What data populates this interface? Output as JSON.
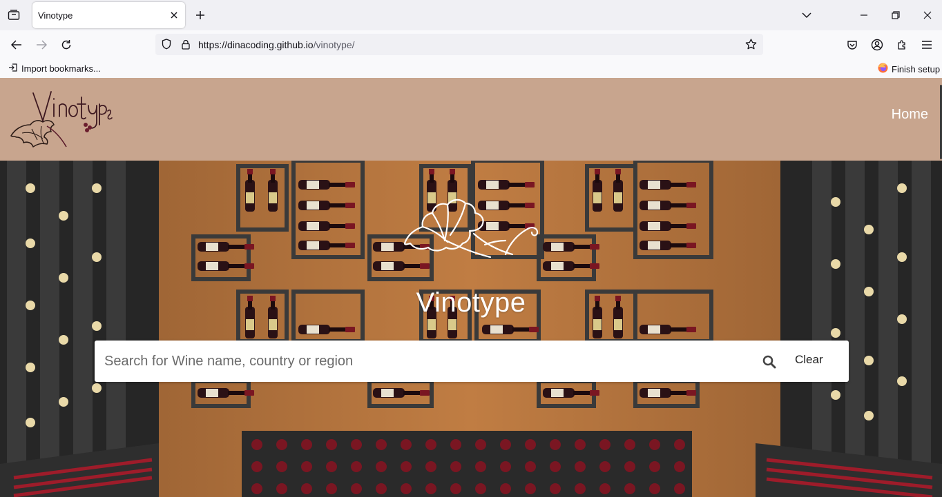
{
  "browser": {
    "tab": {
      "title": "Vinotype"
    },
    "url": {
      "host": "https://dinacoding.github.io",
      "path": "/vinotype/"
    },
    "bookmarks": {
      "import_label": "Import bookmarks...",
      "finish_setup_label": "Finish setup"
    }
  },
  "site": {
    "nav": {
      "home_label": "Home"
    },
    "hero": {
      "title": "Vinotype",
      "search_placeholder": "Search for Wine name, country or region",
      "clear_label": "Clear"
    }
  }
}
